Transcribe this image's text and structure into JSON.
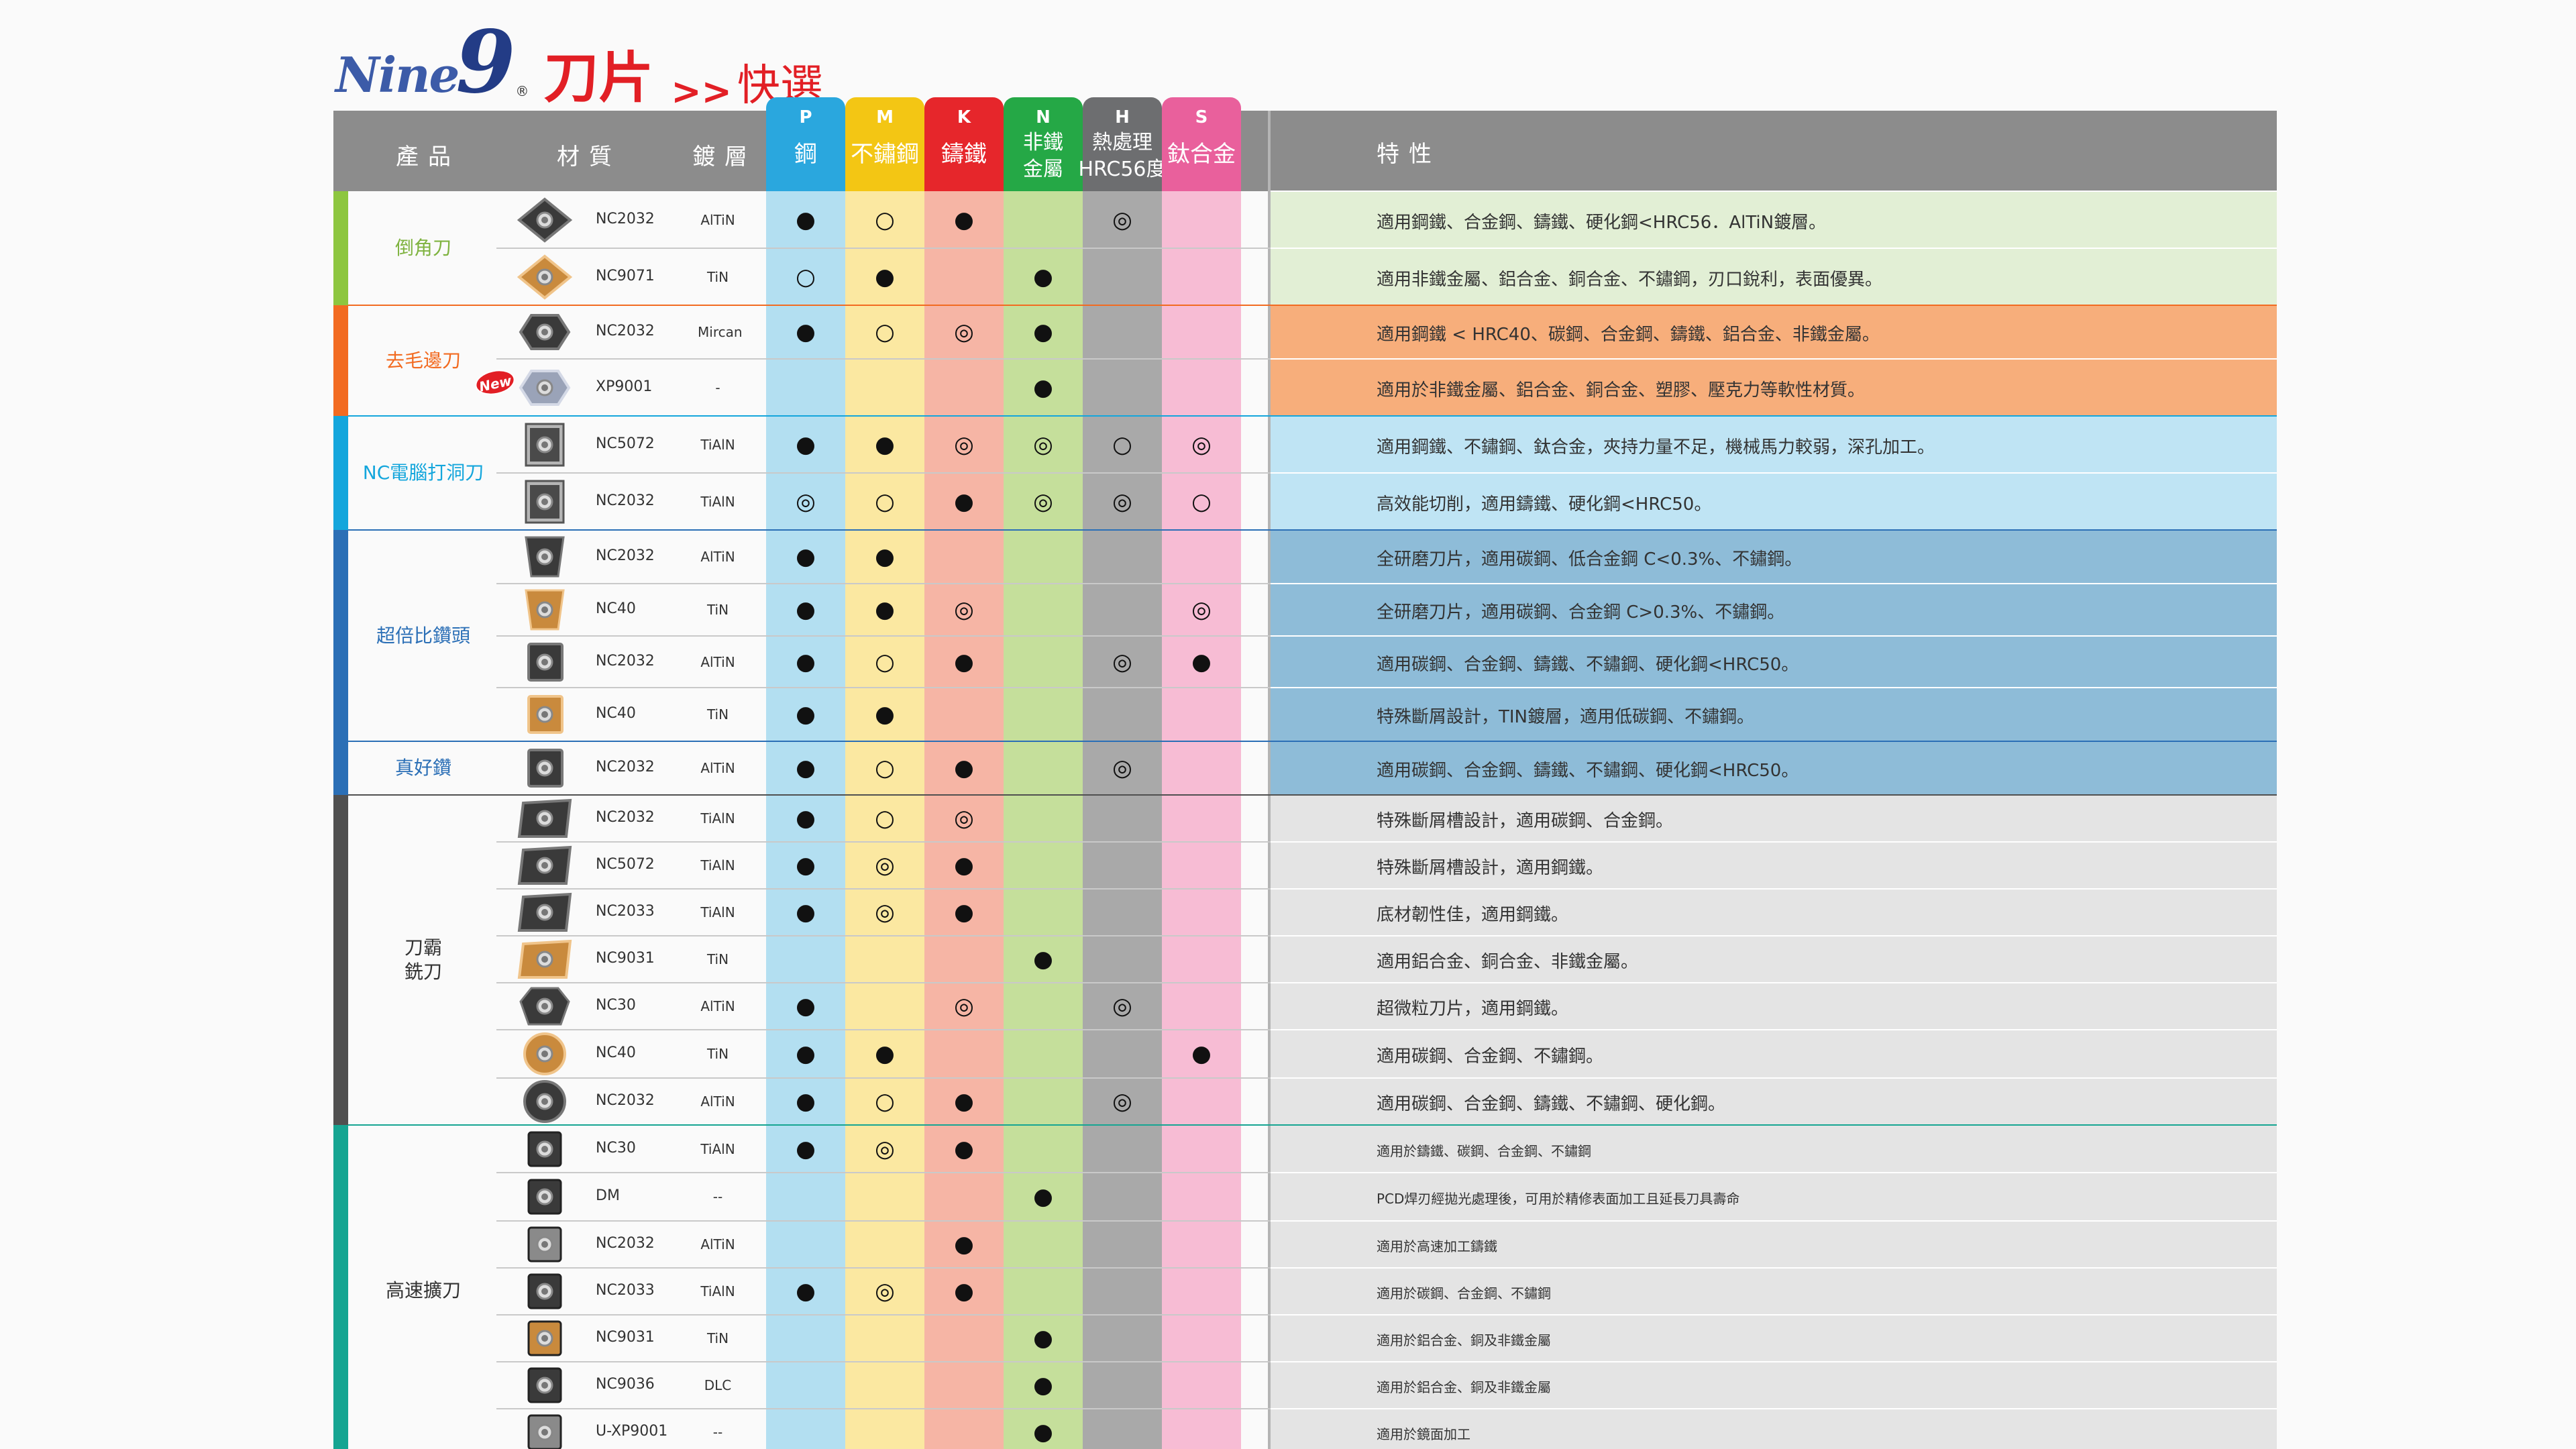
{
  "title": {
    "brand": "Nine",
    "brand_num": "9",
    "brand_reg": "®",
    "main": "刀片",
    "separator": ">>",
    "sub": "快選"
  },
  "header": {
    "product": "產品",
    "material": "材質",
    "coating": "鍍層",
    "features": "特性"
  },
  "columns": [
    {
      "letter": "P",
      "name": "鋼",
      "color": "#2aa7de",
      "body": "#b3dff1"
    },
    {
      "letter": "M",
      "name": "不鏽鋼",
      "color": "#f3c614",
      "body": "#fbe8a1"
    },
    {
      "letter": "K",
      "name": "鑄鐵",
      "color": "#e6262b",
      "body": "#f6b5a5"
    },
    {
      "letter": "N",
      "name": "非鐵\n金屬",
      "color": "#25a846",
      "body": "#c5df9b"
    },
    {
      "letter": "H",
      "name": "熱處理\nHRC56度",
      "color": "#6d6e70",
      "body": "#a9a9a9"
    },
    {
      "letter": "S",
      "name": "鈦合金",
      "color": "#e9609c",
      "body": "#f7bcd4"
    }
  ],
  "legend_marks": {
    "best": "●",
    "good": "◎",
    "ok": "○"
  },
  "categories": [
    {
      "name": "倒角刀",
      "color": "#8dc63f",
      "textcolor": "#7fb340",
      "feat_bg": "#e2efd5",
      "start": 0,
      "count": 2
    },
    {
      "name": "去毛邊刀",
      "color": "#f26b21",
      "textcolor": "#f26b21",
      "feat_bg": "#f7ae7b",
      "start": 2,
      "count": 2
    },
    {
      "name": "NC電腦打洞刀",
      "color": "#14a6dc",
      "textcolor": "#14a6dc",
      "feat_bg": "#bfe4f4",
      "start": 4,
      "count": 2
    },
    {
      "name": "超倍比鑽頭",
      "color": "#2b6fb6",
      "textcolor": "#2b6fb6",
      "feat_bg": "#8ebcd8",
      "start": 6,
      "count": 4
    },
    {
      "name": "真好鑽",
      "color": "#2b6fb6",
      "textcolor": "#2b6fb6",
      "feat_bg": "#8ebcd8",
      "start": 10,
      "count": 1
    },
    {
      "name": "刀霸\n銑刀",
      "color": "#505050",
      "textcolor": "#333333",
      "feat_bg": "#e4e4e4",
      "start": 11,
      "count": 7
    },
    {
      "name": "高速擴刀",
      "color": "#16a592",
      "textcolor": "#333333",
      "feat_bg": "#e4e4e4",
      "start": 18,
      "count": 7
    }
  ],
  "rows": [
    {
      "material": "NC2032",
      "coating": "AlTiN",
      "marks": [
        "●",
        "○",
        "●",
        "",
        "◎",
        ""
      ],
      "feature": "適用鋼鐵、合金鋼、鑄鐵、硬化鋼<HRC56．AlTiN鍍層。",
      "insert": "rhombus-gray"
    },
    {
      "material": "NC9071",
      "coating": "TiN",
      "marks": [
        "○",
        "●",
        "",
        "●",
        "",
        ""
      ],
      "feature": "適用非鐵金屬、鋁合金、銅合金、不鏽鋼，刃口銳利，表面優異。",
      "insert": "rhombus-gold"
    },
    {
      "material": "NC2032",
      "coating": "Mircan",
      "marks": [
        "●",
        "○",
        "◎",
        "●",
        "",
        ""
      ],
      "feature": "適用鋼鐵 < HRC40、碳鋼、合金鋼、鑄鐵、鋁合金、非鐵金屬。",
      "insert": "hex-dark"
    },
    {
      "material": "XP9001",
      "coating": "-",
      "marks": [
        "",
        "",
        "",
        "●",
        "",
        ""
      ],
      "feature": "適用於非鐵金屬、鋁合金、銅合金、塑膠、壓克力等軟性材質。",
      "insert": "hex-light",
      "badge": "New"
    },
    {
      "material": "NC5072",
      "coating": "TiAlN",
      "marks": [
        "●",
        "●",
        "◎",
        "◎",
        "○",
        "◎"
      ],
      "feature": "適用鋼鐵、不鏽鋼、鈦合金，夾持力量不足，機械馬力較弱，深孔加工。",
      "insert": "square-serrated"
    },
    {
      "material": "NC2032",
      "coating": "TiAlN",
      "marks": [
        "◎",
        "○",
        "●",
        "◎",
        "◎",
        "○"
      ],
      "feature": "高效能切削，適用鑄鐵、硬化鋼<HRC50。",
      "insert": "square-serrated"
    },
    {
      "material": "NC2032",
      "coating": "AlTiN",
      "marks": [
        "●",
        "●",
        "",
        "",
        "",
        ""
      ],
      "feature": "全研磨刀片，適用碳鋼、低合金鋼 C<0.3%、不鏽鋼。",
      "insert": "trap-dark"
    },
    {
      "material": "NC40",
      "coating": "TiN",
      "marks": [
        "●",
        "●",
        "◎",
        "",
        "",
        "◎"
      ],
      "feature": "全研磨刀片，適用碳鋼、合金鋼 C>0.3%、不鏽鋼。",
      "insert": "trap-gold"
    },
    {
      "material": "NC2032",
      "coating": "AlTiN",
      "marks": [
        "●",
        "○",
        "●",
        "",
        "◎",
        "●"
      ],
      "feature": "適用碳鋼、合金鋼、鑄鐵、不鏽鋼、硬化鋼<HRC50。",
      "insert": "square-gray"
    },
    {
      "material": "NC40",
      "coating": "TiN",
      "marks": [
        "●",
        "●",
        "",
        "",
        "",
        ""
      ],
      "feature": "特殊斷屑設計，TIN鍍層，適用低碳鋼、不鏽鋼。",
      "insert": "square-gold"
    },
    {
      "material": "NC2032",
      "coating": "AlTiN",
      "marks": [
        "●",
        "○",
        "●",
        "",
        "◎",
        ""
      ],
      "feature": "適用碳鋼、合金鋼、鑄鐵、不鏽鋼、硬化鋼<HRC50。",
      "insert": "square-gray"
    },
    {
      "material": "NC2032",
      "coating": "TiAlN",
      "marks": [
        "●",
        "○",
        "◎",
        "",
        "",
        ""
      ],
      "feature": "特殊斷屑槽設計，適用碳鋼、合金鋼。",
      "insert": "para-dark"
    },
    {
      "material": "NC5072",
      "coating": "TiAlN",
      "marks": [
        "●",
        "◎",
        "●",
        "",
        "",
        ""
      ],
      "feature": "特殊斷屑槽設計，適用鋼鐵。",
      "insert": "para-dark"
    },
    {
      "material": "NC2033",
      "coating": "TiAlN",
      "marks": [
        "●",
        "◎",
        "●",
        "",
        "",
        ""
      ],
      "feature": "底材韌性佳，適用鋼鐵。",
      "insert": "para-dark"
    },
    {
      "material": "NC9031",
      "coating": "TiN",
      "marks": [
        "",
        "",
        "",
        "●",
        "",
        ""
      ],
      "feature": "適用鋁合金、銅合金、非鐵金屬。",
      "insert": "para-gold"
    },
    {
      "material": "NC30",
      "coating": "AlTiN",
      "marks": [
        "●",
        "",
        "◎",
        "",
        "◎",
        ""
      ],
      "feature": "超微粒刀片，適用鋼鐵。",
      "insert": "octo-dark"
    },
    {
      "material": "NC40",
      "coating": "TiN",
      "marks": [
        "●",
        "●",
        "",
        "",
        "",
        "●"
      ],
      "feature": "適用碳鋼、合金鋼、不鏽鋼。",
      "insert": "round-gold"
    },
    {
      "material": "NC2032",
      "coating": "AlTiN",
      "marks": [
        "●",
        "○",
        "●",
        "",
        "◎",
        ""
      ],
      "feature": "適用碳鋼、合金鋼、鑄鐵、不鏽鋼、硬化鋼。",
      "insert": "round-dark"
    },
    {
      "material": "NC30",
      "coating": "TiAlN",
      "marks": [
        "●",
        "◎",
        "●",
        "",
        "",
        ""
      ],
      "feature": "適用於鑄鐵、碳鋼、合金鋼、不鏽鋼",
      "insert": "tri-dark",
      "small": true
    },
    {
      "material": "DM",
      "coating": "--",
      "marks": [
        "",
        "",
        "",
        "●",
        "",
        ""
      ],
      "feature": "PCD焊刃經拋光處理後，可用於精修表面加工且延長刀具壽命",
      "insert": "tri-pcd",
      "small": true
    },
    {
      "material": "NC2032",
      "coating": "AlTiN",
      "marks": [
        "",
        "",
        "●",
        "",
        "",
        ""
      ],
      "feature": "適用於高速加工鑄鐵",
      "insert": "tri-silver",
      "small": true
    },
    {
      "material": "NC2033",
      "coating": "TiAlN",
      "marks": [
        "●",
        "◎",
        "●",
        "",
        "",
        ""
      ],
      "feature": "適用於碳鋼、合金鋼、不鏽鋼",
      "insert": "tri-dark",
      "small": true
    },
    {
      "material": "NC9031",
      "coating": "TiN",
      "marks": [
        "",
        "",
        "",
        "●",
        "",
        ""
      ],
      "feature": "適用於鋁合金、銅及非鐵金屬",
      "insert": "tri-gold",
      "small": true
    },
    {
      "material": "NC9036",
      "coating": "DLC",
      "marks": [
        "",
        "",
        "",
        "●",
        "",
        ""
      ],
      "feature": "適用於鋁合金、銅及非鐵金屬",
      "insert": "tri-dark",
      "small": true
    },
    {
      "material": "U-XP9001",
      "coating": "--",
      "marks": [
        "",
        "",
        "",
        "●",
        "",
        ""
      ],
      "feature": "適用於鏡面加工",
      "insert": "tri-silver",
      "small": true
    }
  ]
}
